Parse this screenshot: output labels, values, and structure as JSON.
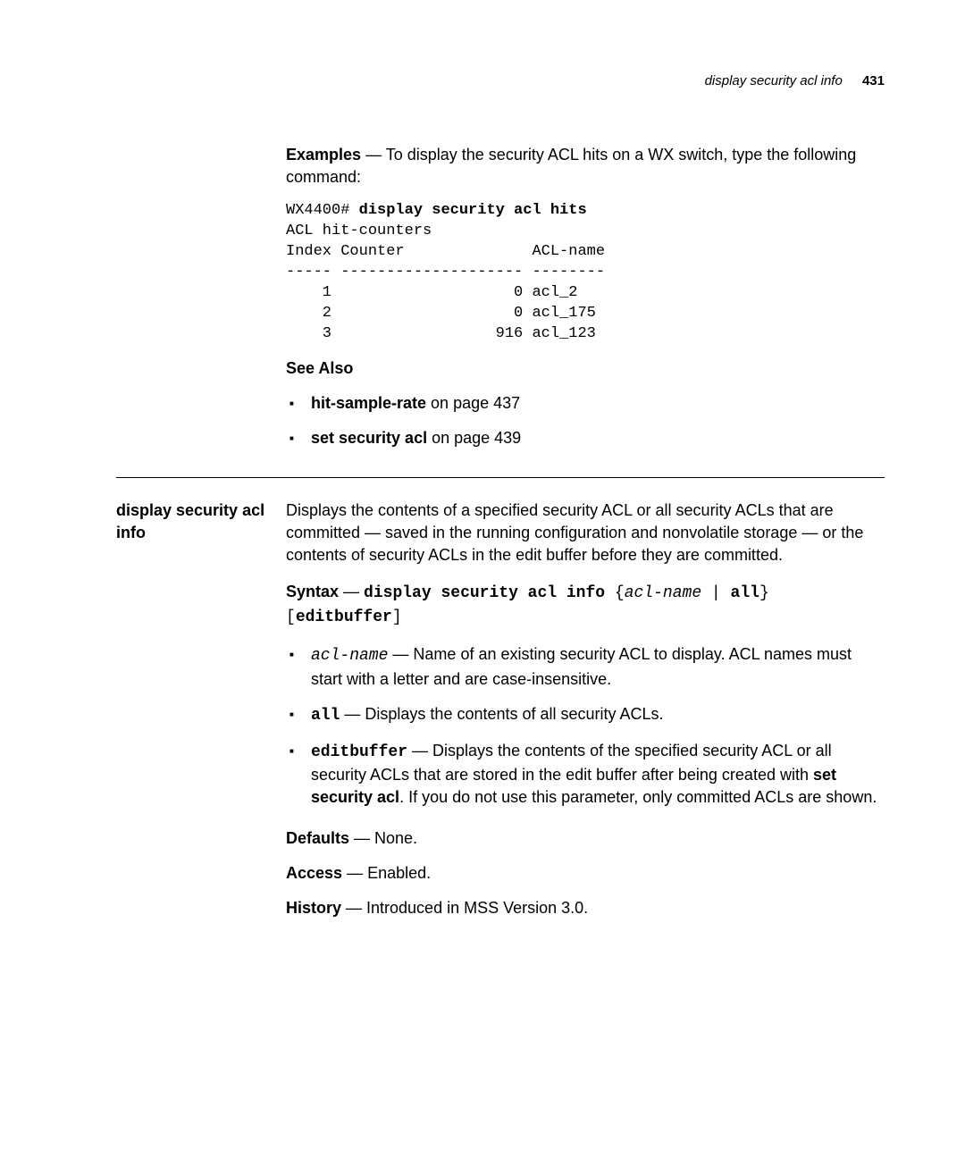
{
  "header": {
    "title": "display security acl info",
    "page": "431"
  },
  "examples": {
    "label": "Examples",
    "text": " — To display the security ACL hits on a WX switch, type the following command:"
  },
  "code": {
    "prompt": "WX4400# ",
    "command": "display security acl hits",
    "body": "ACL hit-counters\nIndex Counter              ACL-name\n----- -------------------- --------\n    1                    0 acl_2\n    2                    0 acl_175\n    3                  916 acl_123"
  },
  "seealso": {
    "heading": "See Also",
    "items": [
      {
        "bold": "hit-sample-rate",
        "rest": " on page 437"
      },
      {
        "bold": "set security acl",
        "rest": " on page 439"
      }
    ]
  },
  "section": {
    "label": "display security acl info",
    "intro": "Displays the contents of a specified security ACL or all security ACLs that are committed — saved in the running configuration and nonvolatile storage — or the contents of security ACLs in the edit buffer before they are committed.",
    "syntax": {
      "label": "Syntax",
      "prefix": " — ",
      "cmd": "display security acl  info",
      "open_brace": " {",
      "param": "acl-name",
      "pipe": " | ",
      "all": "all",
      "close_brace": "} ",
      "editbuffer_open": "[",
      "editbuffer": "editbuffer",
      "editbuffer_close": "]"
    },
    "params": [
      {
        "code": "acl-name",
        "codeStyle": "italic",
        "desc": " — Name of an existing security ACL to display. ACL names must start with a letter and are case-insensitive."
      },
      {
        "code": "all",
        "codeStyle": "bold",
        "desc": " — Displays the contents of all security ACLs."
      },
      {
        "code": "editbuffer",
        "codeStyle": "bold",
        "desc_before": " — Displays the contents of the specified security ACL or all security ACLs that are stored in the edit buffer after being created with ",
        "bold_inline": "set security acl",
        "desc_after": ". If you do not use this parameter, only committed ACLs are shown."
      }
    ],
    "defaults": {
      "label": "Defaults",
      "text": " — None."
    },
    "access": {
      "label": "Access",
      "text": " — Enabled."
    },
    "history": {
      "label": "History",
      "text": " — Introduced in MSS Version 3.0."
    }
  }
}
